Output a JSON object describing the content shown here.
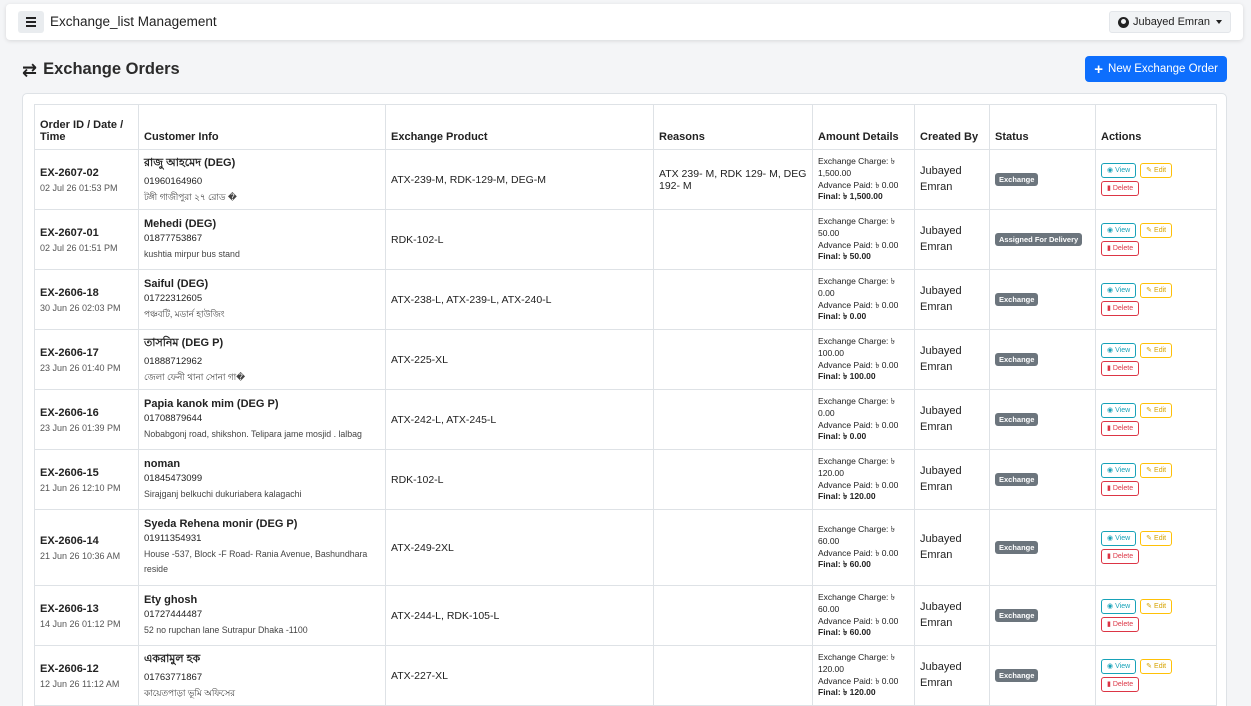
{
  "header": {
    "app_title": "Exchange_list Management",
    "user_name": "Jubayed Emran",
    "icons": {
      "menu": "hamburger-icon",
      "user": "user-circle-icon",
      "caret": "caret-down-icon"
    }
  },
  "page": {
    "title": "Exchange Orders",
    "title_icon": "swap-arrows-icon",
    "new_button": "New Exchange Order"
  },
  "table": {
    "headers": [
      "Order ID / Date / Time",
      "Customer Info",
      "Exchange Product",
      "Reasons",
      "Amount Details",
      "Created By",
      "Status",
      "Actions"
    ],
    "labels": {
      "charge": "Exchange Charge:",
      "advance": "Advance Paid:",
      "final": "Final:",
      "view": "View",
      "edit": "Edit",
      "delete": "Delete"
    },
    "rows": [
      {
        "id": "EX-2607-02",
        "date": "02 Jul 26 01:53 PM",
        "name": "রাজু আহমেদ (DEG)",
        "phone": "01960164960",
        "address": "টঙ্গী গাজীপুরা ২৭ রোড �",
        "product": "ATX-239-M, RDK-129-M, DEG-M",
        "reasons": "ATX 239- M, RDK 129- M, DEG 192- M",
        "charge": "৳ 1,500.00",
        "advance": "৳ 0.00",
        "final": "৳ 1,500.00",
        "created_by": "Jubayed Emran",
        "status": "Exchange"
      },
      {
        "id": "EX-2607-01",
        "date": "02 Jul 26 01:51 PM",
        "name": "Mehedi (DEG)",
        "phone": "01877753867",
        "address": "kushtia mirpur bus stand",
        "product": "RDK-102-L",
        "reasons": "",
        "charge": "৳ 50.00",
        "advance": "৳ 0.00",
        "final": "৳ 50.00",
        "created_by": "Jubayed Emran",
        "status": "Assigned For Delivery"
      },
      {
        "id": "EX-2606-18",
        "date": "30 Jun 26 02:03 PM",
        "name": "Saiful (DEG)",
        "phone": "01722312605",
        "address": "পঞ্চবটি, মডার্ন হাউজিং",
        "product": "ATX-238-L, ATX-239-L, ATX-240-L",
        "reasons": "",
        "charge": "৳ 0.00",
        "advance": "৳ 0.00",
        "final": "৳ 0.00",
        "created_by": "Jubayed Emran",
        "status": "Exchange"
      },
      {
        "id": "EX-2606-17",
        "date": "23 Jun 26 01:40 PM",
        "name": "তাসনিম (DEG P)",
        "phone": "01888712962",
        "address": "জেলা ফেনী থানা সোনা গা�",
        "product": "ATX-225-XL",
        "reasons": "",
        "charge": "৳ 100.00",
        "advance": "৳ 0.00",
        "final": "৳ 100.00",
        "created_by": "Jubayed Emran",
        "status": "Exchange"
      },
      {
        "id": "EX-2606-16",
        "date": "23 Jun 26 01:39 PM",
        "name": "Papia kanok mim (DEG P)",
        "phone": "01708879644",
        "address": "Nobabgonj road, shikshon. Telipara jame mosjid . lalbag",
        "product": "ATX-242-L, ATX-245-L",
        "reasons": "",
        "charge": "৳ 0.00",
        "advance": "৳ 0.00",
        "final": "৳ 0.00",
        "created_by": "Jubayed Emran",
        "status": "Exchange"
      },
      {
        "id": "EX-2606-15",
        "date": "21 Jun 26 12:10 PM",
        "name": "noman",
        "phone": "01845473099",
        "address": "Sirajganj belkuchi dukuriabera kalagachi",
        "product": "RDK-102-L",
        "reasons": "",
        "charge": "৳ 120.00",
        "advance": "৳ 0.00",
        "final": "৳ 120.00",
        "created_by": "Jubayed Emran",
        "status": "Exchange"
      },
      {
        "id": "EX-2606-14",
        "date": "21 Jun 26 10:36 AM",
        "name": "Syeda Rehena monir (DEG P)",
        "phone": "01911354931",
        "address": "House -537, Block -F Road- Rania Avenue, Bashundhara reside",
        "product": "ATX-249-2XL",
        "reasons": "",
        "charge": "৳ 60.00",
        "advance": "৳ 0.00",
        "final": "৳ 60.00",
        "created_by": "Jubayed Emran",
        "status": "Exchange"
      },
      {
        "id": "EX-2606-13",
        "date": "14 Jun 26 01:12 PM",
        "name": "Ety ghosh",
        "phone": "01727444487",
        "address": "52 no rupchan lane Sutrapur Dhaka -1100",
        "product": "ATX-244-L, RDK-105-L",
        "reasons": "",
        "charge": "৳ 60.00",
        "advance": "৳ 0.00",
        "final": "৳ 60.00",
        "created_by": "Jubayed Emran",
        "status": "Exchange"
      },
      {
        "id": "EX-2606-12",
        "date": "12 Jun 26 11:12 AM",
        "name": "একরামুল হক",
        "phone": "01763771867",
        "address": "কায়েতপাড়া ভূমি অফিসের",
        "product": "ATX-227-XL",
        "reasons": "",
        "charge": "৳ 120.00",
        "advance": "৳ 0.00",
        "final": "৳ 120.00",
        "created_by": "Jubayed Emran",
        "status": "Exchange"
      }
    ]
  }
}
